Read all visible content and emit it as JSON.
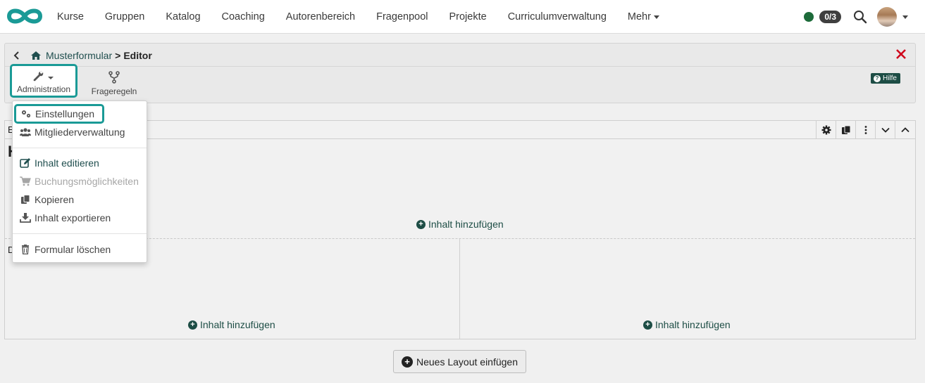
{
  "nav": {
    "items": [
      "Kurse",
      "Gruppen",
      "Katalog",
      "Coaching",
      "Autorenbereich",
      "Fragenpool",
      "Projekte",
      "Curriculumverwaltung",
      "Mehr"
    ],
    "badge": "0/3",
    "status_color": "#1d6b3a",
    "logo_color": "#1a9a96"
  },
  "breadcrumb": {
    "parent": "Musterformular",
    "separator": ">",
    "current": "Editor"
  },
  "toolbar": {
    "admin_label": "Administration",
    "rules_label": "Frageregeln",
    "help_label": "Hilfe"
  },
  "content": {
    "block_label_top": "E",
    "block_heading": "H",
    "block_label_bottom": "D",
    "add_content_label": "Inhalt hinzufügen",
    "new_layout_label": "Neues Layout einfügen"
  },
  "dropdown": {
    "settings": "Einstellungen",
    "members": "Mitgliederverwaltung",
    "edit_content": "Inhalt editieren",
    "booking": "Buchungsmöglichkeiten",
    "copy": "Kopieren",
    "export": "Inhalt exportieren",
    "delete": "Formular löschen"
  },
  "colors": {
    "accent": "#1a9a96",
    "dark_teal": "#1d4d45",
    "close_red": "#d0021b"
  }
}
